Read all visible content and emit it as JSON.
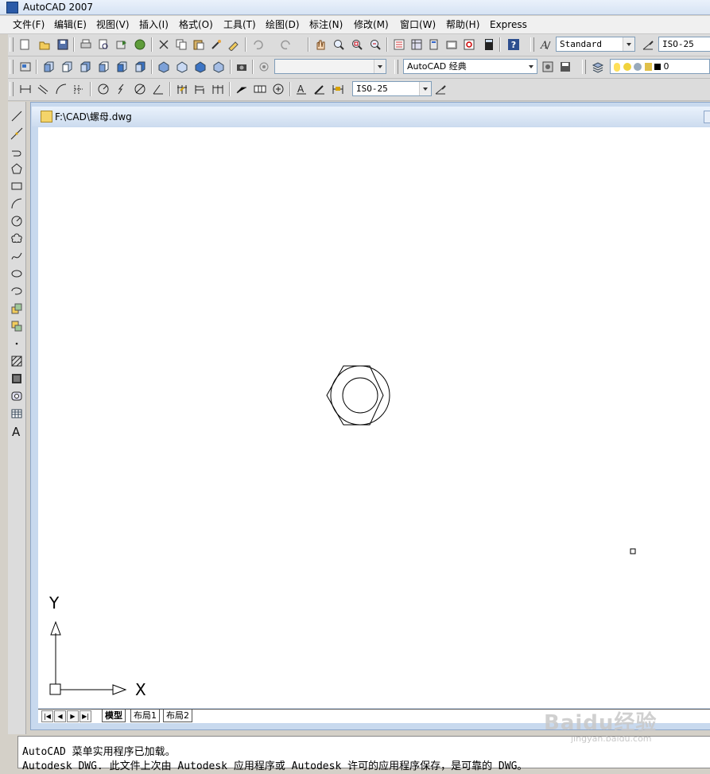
{
  "window": {
    "title": "AutoCAD 2007"
  },
  "menu": [
    "文件(F)",
    "编辑(E)",
    "视图(V)",
    "插入(I)",
    "格式(O)",
    "工具(T)",
    "绘图(D)",
    "标注(N)",
    "修改(M)",
    "窗口(W)",
    "帮助(H)",
    "Express"
  ],
  "toolbar": {
    "text_style": "Standard",
    "dim_style": "ISO-25",
    "workspace": "AutoCAD 经典",
    "layer": "0",
    "dim_style_2": "ISO-25"
  },
  "document": {
    "title": "F:\\CAD\\螺母.dwg"
  },
  "layout_tabs": [
    "模型",
    "布局1",
    "布局2"
  ],
  "ucs": {
    "x_label": "X",
    "y_label": "Y"
  },
  "command_lines": [
    "AutoCAD 菜单实用程序已加载。",
    "Autodesk DWG.  此文件上次由 Autodesk 应用程序或 Autodesk 许可的应用程序保存，是可靠的 DWG。"
  ],
  "watermark": {
    "text": "Baidu经验",
    "sub": "jingyan.baidu.com"
  },
  "colors": {
    "canvas": "#ffffff",
    "frame": "#c8d9ee",
    "toolbar": "#dcdcdc"
  },
  "icons": {
    "standard": [
      "new-icon",
      "open-icon",
      "save-icon",
      "print-icon",
      "plot-preview-icon",
      "publish-icon",
      "3d-dwf-icon",
      "cut-icon",
      "copy-icon",
      "paste-icon",
      "match-properties-icon",
      "block-editor-icon",
      "undo-icon",
      "redo-icon",
      "pan-icon",
      "zoom-realtime-icon",
      "zoom-window-icon",
      "zoom-previous-icon",
      "properties-icon",
      "design-center-icon",
      "tool-palettes-icon",
      "sheet-set-icon",
      "markup-icon",
      "calculator-icon",
      "help-icon"
    ],
    "draw": [
      "line-icon",
      "construction-line-icon",
      "polyline-icon",
      "polygon-icon",
      "rectangle-icon",
      "arc-icon",
      "circle-icon",
      "revision-cloud-icon",
      "spline-icon",
      "ellipse-icon",
      "ellipse-arc-icon",
      "insert-block-icon",
      "make-block-icon",
      "point-icon",
      "hatch-icon",
      "gradient-icon",
      "region-icon",
      "table-icon",
      "multiline-text-icon"
    ]
  }
}
